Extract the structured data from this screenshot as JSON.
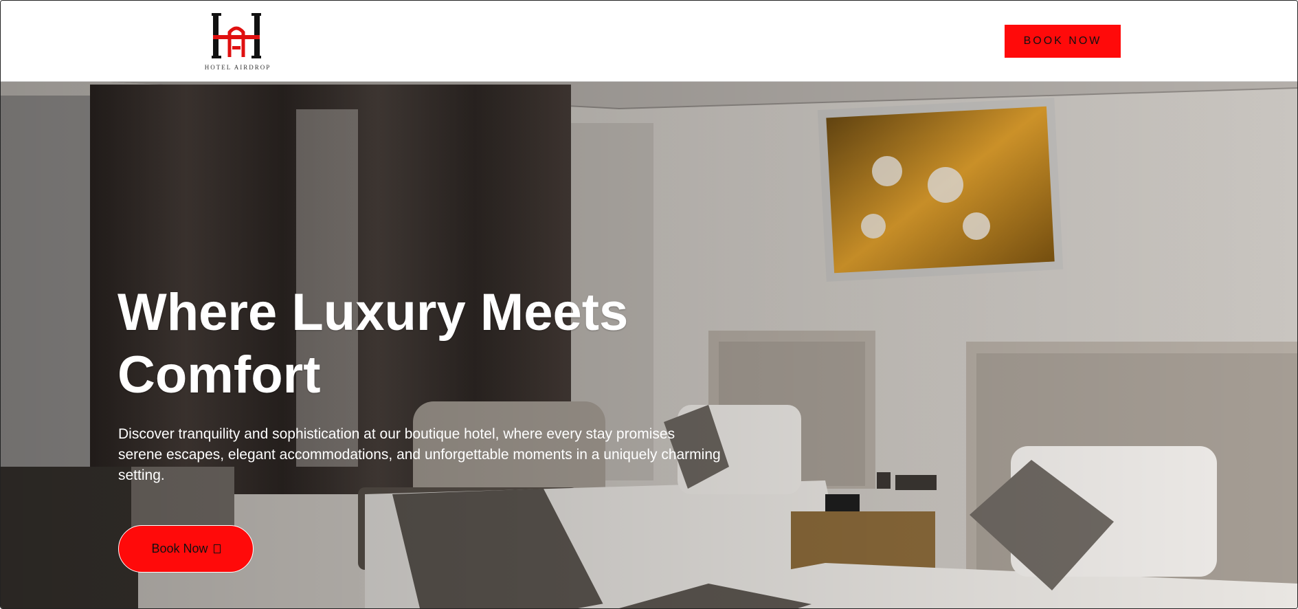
{
  "header": {
    "logo_text": "HOTEL AIRDROP",
    "logo_icon": "hotel-monogram-icon",
    "book_button_label": "BOOK NOW"
  },
  "hero": {
    "title": "Where Luxury Meets Comfort",
    "description": "Discover tranquility and sophistication at our boutique hotel, where every stay promises serene escapes, elegant accommodations, and unforgettable moments in a uniquely charming setting.",
    "button_label": "Book Now",
    "button_icon": "arrow-icon",
    "background_image": "hotel-twin-bedroom-photo"
  },
  "colors": {
    "accent": "#ff0a0a",
    "header_bg": "#ffffff",
    "hero_text": "#ffffff"
  }
}
